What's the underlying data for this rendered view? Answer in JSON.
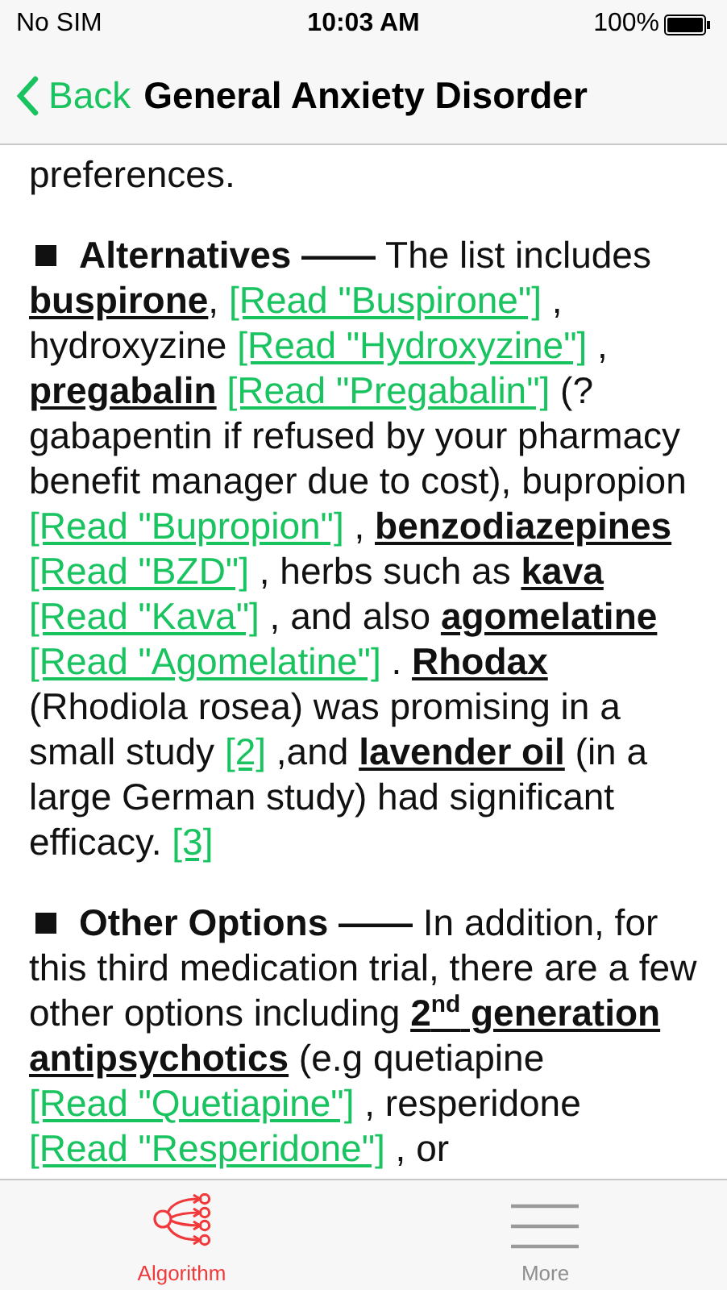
{
  "status_bar": {
    "carrier": "No SIM",
    "time": "10:03 AM",
    "battery": "100%"
  },
  "nav": {
    "back": "Back",
    "title": "General Anxiety Disorder"
  },
  "content": [
    {
      "bullet": false,
      "segments": [
        {
          "kind": "plain",
          "text": "preferences."
        }
      ]
    },
    {
      "bullet": true,
      "segments": [
        {
          "kind": "heading",
          "text": "Alternatives ——"
        },
        {
          "kind": "plain",
          "text": " The list includes "
        },
        {
          "kind": "bold",
          "text": "buspirone"
        },
        {
          "kind": "plain",
          "text": ", "
        },
        {
          "kind": "link",
          "text": "[Read \"Buspirone\"]"
        },
        {
          "kind": "plain",
          "text": " , hydroxyzine "
        },
        {
          "kind": "link",
          "text": "[Read \"Hydroxyzine\"]"
        },
        {
          "kind": "plain",
          "text": " , "
        },
        {
          "kind": "bold",
          "text": "pregabalin"
        },
        {
          "kind": "link",
          "text": "[Read \"Pregabalin\"]"
        },
        {
          "kind": "plain",
          "text": " (? gabapentin if refused by your pharmacy benefit manager due to cost), bupropion "
        },
        {
          "kind": "link",
          "text": "[Read \"Bupropion\"]"
        },
        {
          "kind": "plain",
          "text": " , "
        },
        {
          "kind": "bold",
          "text": "benzodiazepines"
        },
        {
          "kind": "link",
          "text": "[Read \"BZD\"]"
        },
        {
          "kind": "plain",
          "text": " , herbs such as "
        },
        {
          "kind": "bold",
          "text": "kava"
        },
        {
          "kind": "link",
          "text": "[Read \"Kava\"]"
        },
        {
          "kind": "plain",
          "text": " , and also "
        },
        {
          "kind": "bold",
          "text": "agomelatine"
        },
        {
          "kind": "link",
          "text": "[Read \"Agomelatine\"]"
        },
        {
          "kind": "plain",
          "text": " . "
        },
        {
          "kind": "bold",
          "text": "Rhodax"
        },
        {
          "kind": "plain",
          "text": " (Rhodiola rosea) was promising in a small study "
        },
        {
          "kind": "link",
          "text": "[2]"
        },
        {
          "kind": "plain",
          "text": " ,and "
        },
        {
          "kind": "bold",
          "text": "lavender oil"
        },
        {
          "kind": "plain",
          "text": " (in a large German study) had significant efficacy. "
        },
        {
          "kind": "link",
          "text": "[3]"
        }
      ]
    },
    {
      "bullet": true,
      "segments": [
        {
          "kind": "heading",
          "text": "Other Options ——"
        },
        {
          "kind": "plain",
          "text": " In addition, for this third medication trial, there are a few other options including "
        },
        {
          "kind": "bold",
          "text": "2$^{nd}$ generation antipsychotics"
        },
        {
          "kind": "plain",
          "text": " (e.g quetiapine "
        },
        {
          "kind": "link",
          "text": "[Read \"Quetiapine\"]"
        },
        {
          "kind": "plain",
          "text": " , resperidone "
        },
        {
          "kind": "link",
          "text": "[Read \"Resperidone\"]"
        },
        {
          "kind": "plain",
          "text": " , or"
        }
      ]
    }
  ],
  "tabs": [
    {
      "label": "Algorithm",
      "kind": "algorithm",
      "selected": true
    },
    {
      "label": "More",
      "kind": "menu",
      "selected": false
    }
  ]
}
